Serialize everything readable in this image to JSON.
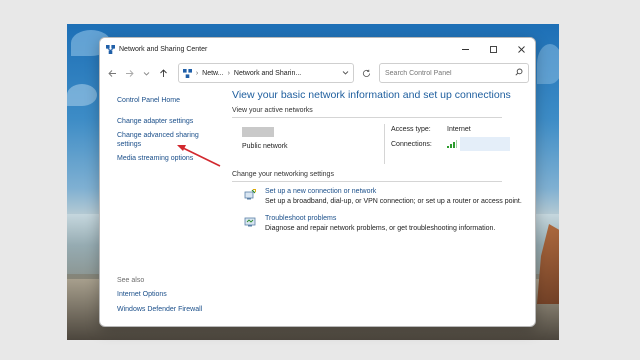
{
  "window": {
    "title": "Network and Sharing Center",
    "controls": [
      "minimize",
      "maximize",
      "close"
    ]
  },
  "navbar": {
    "breadcrumb": [
      "Netw...",
      "Network and Sharin..."
    ],
    "search_placeholder": "Search Control Panel"
  },
  "sidebar": {
    "home": "Control Panel Home",
    "items": [
      "Change adapter settings",
      "Change advanced sharing settings",
      "Media streaming options"
    ],
    "see_also_label": "See also",
    "see_also": [
      "Internet Options",
      "Windows Defender Firewall"
    ]
  },
  "main": {
    "heading": "View your basic network information and set up connections",
    "active_networks_label": "View your active networks",
    "network_type": "Public network",
    "access_type_label": "Access type:",
    "access_type_value": "Internet",
    "connections_label": "Connections:",
    "change_settings_label": "Change your networking settings",
    "tasks": [
      {
        "icon": "new-connection-icon",
        "title": "Set up a new connection or network",
        "description": "Set up a broadband, dial-up, or VPN connection; or set up a router or access point."
      },
      {
        "icon": "troubleshoot-icon",
        "title": "Troubleshoot problems",
        "description": "Diagnose and repair network problems, or get troubleshooting information."
      }
    ]
  },
  "annotation": {
    "arrow_color": "#d2282e"
  }
}
